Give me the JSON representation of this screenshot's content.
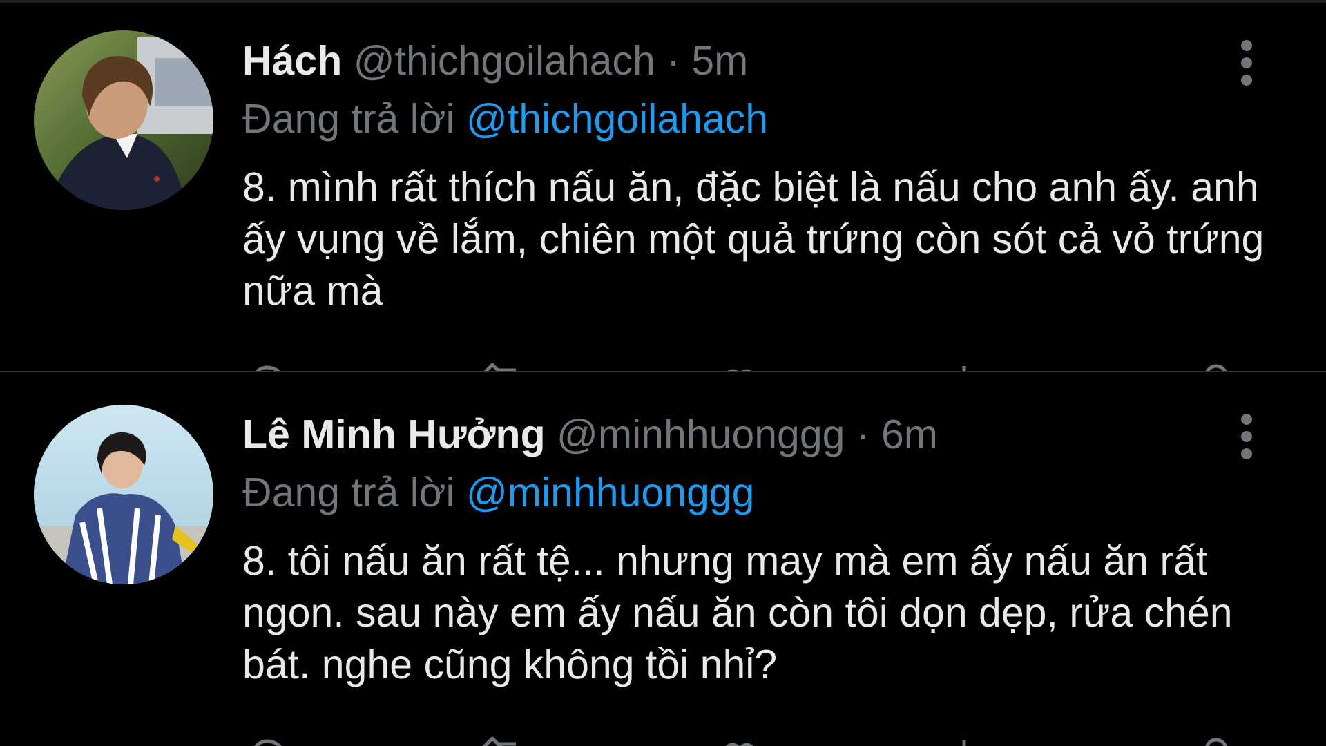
{
  "colors": {
    "background": "#000000",
    "text_primary": "#e7e9ea",
    "text_secondary": "#71767b",
    "accent": "#1d9bf0",
    "divider": "#2f3336"
  },
  "tweets": [
    {
      "display_name": "Hách",
      "handle": "@thichgoilahach",
      "separator": "·",
      "time": "5m",
      "reply_prefix": "Đang trả lời",
      "reply_to": "@thichgoilahach",
      "text": "8. mình rất thích nấu ăn, đặc biệt là nấu cho anh ấy. anh ấy vụng về lắm, chiên một quả trứng còn sót cả vỏ trứng nữa mà",
      "avatar_icon": "avatar-photo",
      "menu_icon": "more-vertical-icon",
      "actions": [
        "reply-icon",
        "retweet-icon",
        "like-icon",
        "share-icon"
      ]
    },
    {
      "display_name": "Lê Minh Hưởng",
      "handle": "@minhhuonggg",
      "separator": "·",
      "time": "6m",
      "reply_prefix": "Đang trả lời",
      "reply_to": "@minhhuonggg",
      "text": "8. tôi nấu ăn rất tệ... nhưng may mà em ấy nấu ăn rất ngon. sau này em ấy nấu ăn còn tôi dọn dẹp, rửa chén bát. nghe cũng không tồi nhỉ?",
      "avatar_icon": "avatar-photo",
      "menu_icon": "more-vertical-icon",
      "actions": [
        "reply-icon",
        "retweet-icon",
        "like-icon",
        "share-icon"
      ]
    }
  ]
}
